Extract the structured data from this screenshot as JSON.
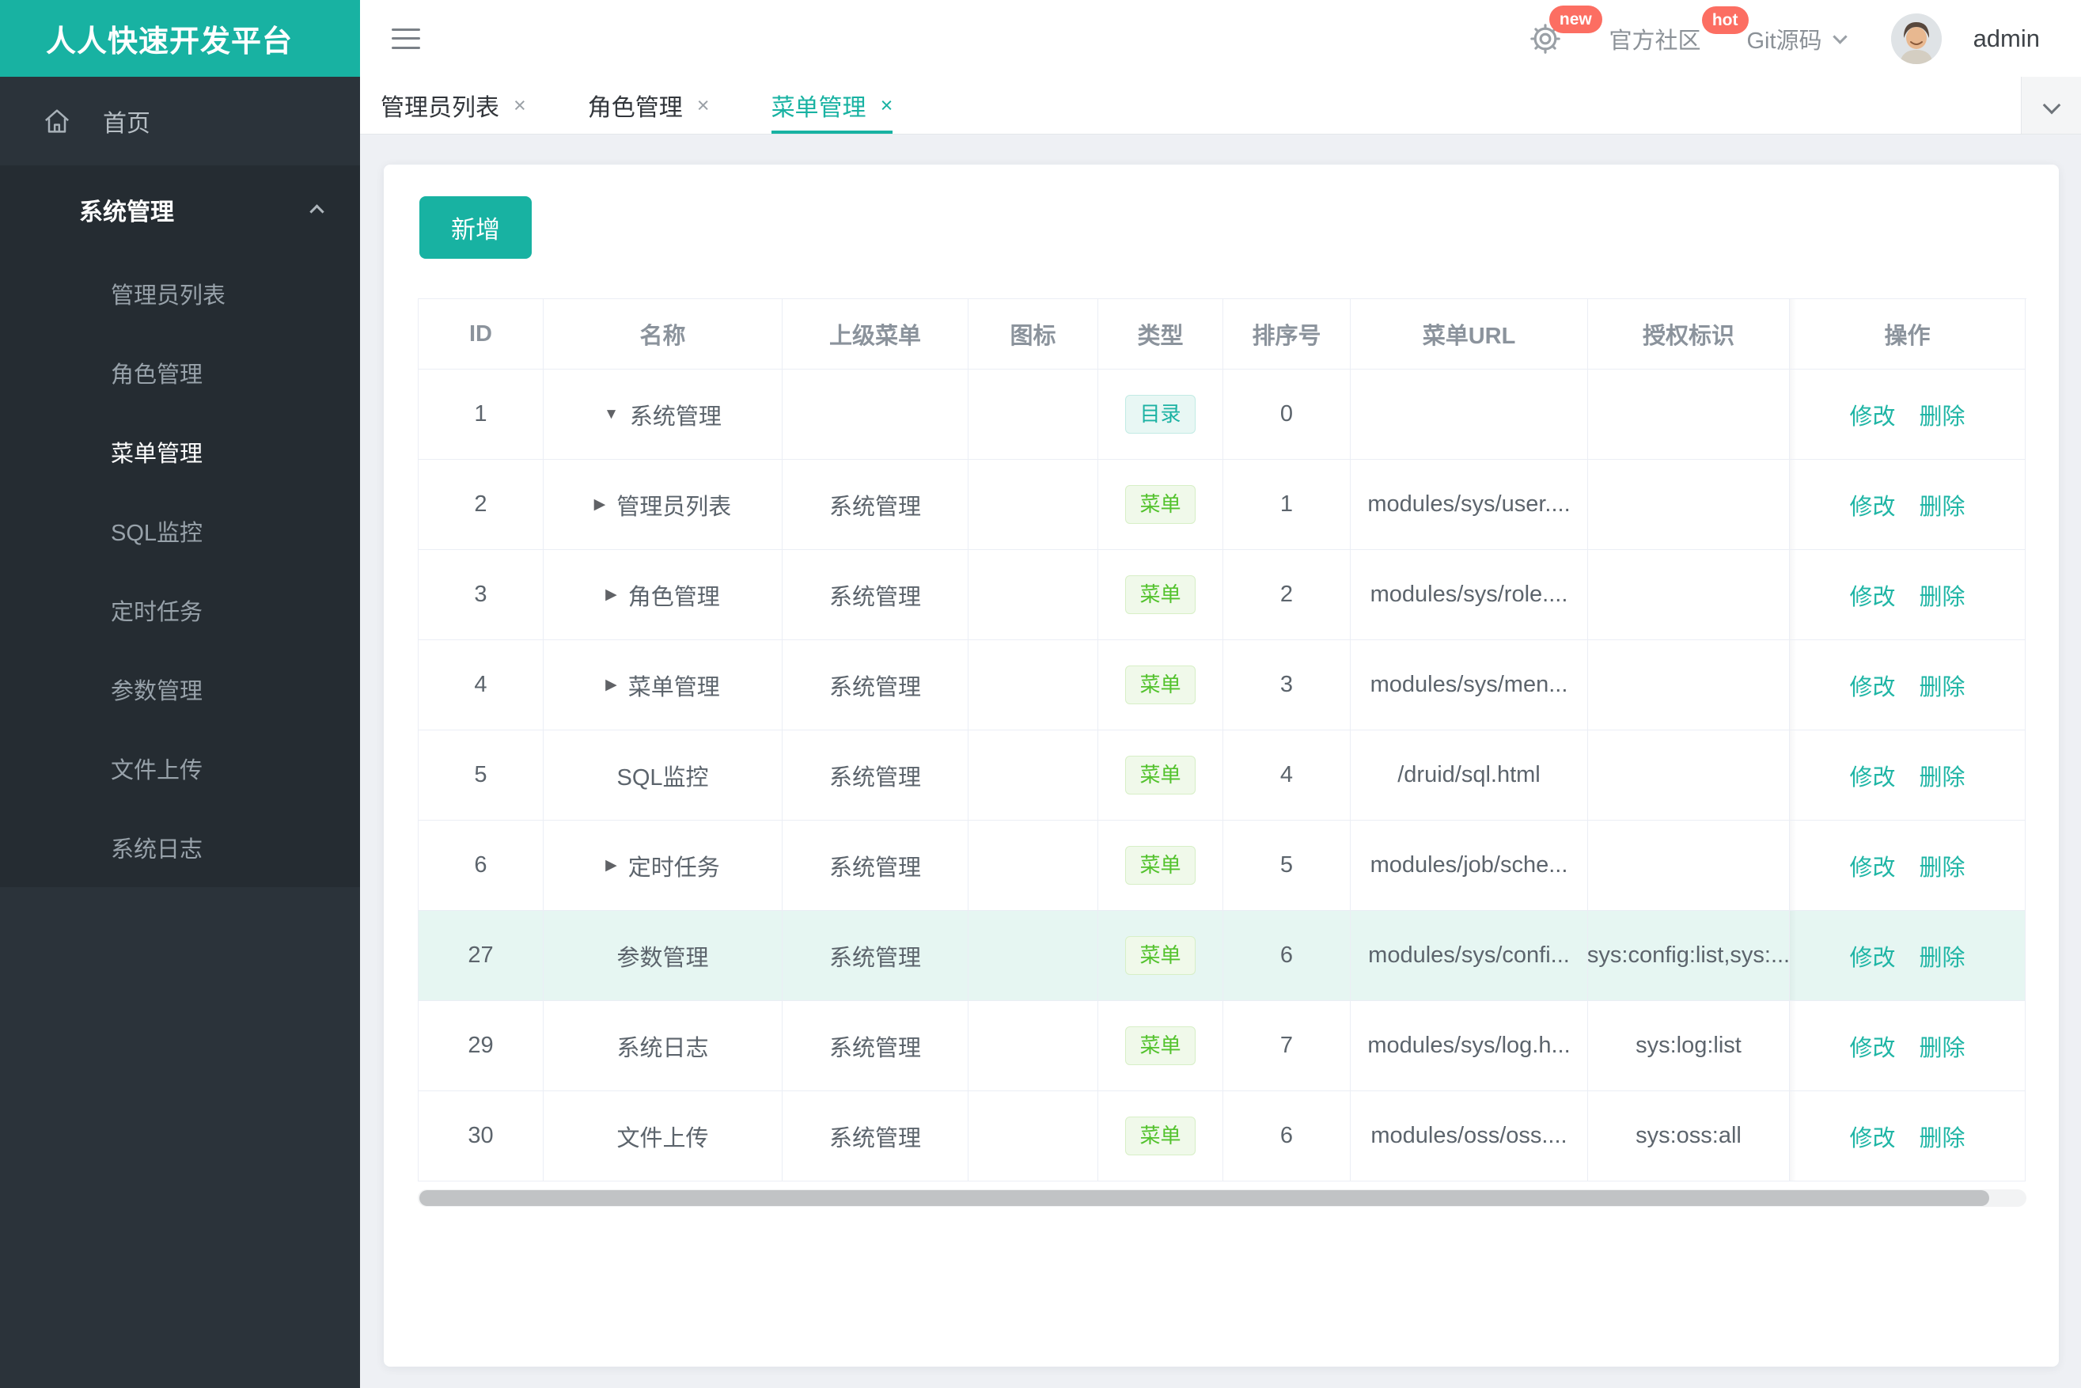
{
  "header": {
    "logo": "人人快速开发平台",
    "nav": {
      "new_badge": "new",
      "community": "官方社区",
      "hot_badge": "hot",
      "git": "Git源码",
      "username": "admin"
    }
  },
  "sidebar": {
    "home_label": "首页",
    "root_label": "系统管理",
    "items": [
      {
        "label": "管理员列表",
        "active": false
      },
      {
        "label": "角色管理",
        "active": false
      },
      {
        "label": "菜单管理",
        "active": true
      },
      {
        "label": "SQL监控",
        "active": false
      },
      {
        "label": "定时任务",
        "active": false
      },
      {
        "label": "参数管理",
        "active": false
      },
      {
        "label": "文件上传",
        "active": false
      },
      {
        "label": "系统日志",
        "active": false
      }
    ]
  },
  "tabs": [
    {
      "label": "管理员列表",
      "active": false
    },
    {
      "label": "角色管理",
      "active": false
    },
    {
      "label": "菜单管理",
      "active": true
    }
  ],
  "toolbar": {
    "add_label": "新增"
  },
  "table": {
    "columns": [
      "ID",
      "名称",
      "上级菜单",
      "图标",
      "类型",
      "排序号",
      "菜单URL",
      "授权标识",
      "操作"
    ],
    "actions": {
      "edit": "修改",
      "delete": "删除"
    },
    "rows": [
      {
        "id": "1",
        "arrow": "down",
        "name": "系统管理",
        "parent": "",
        "type": "目录",
        "kind": "dir",
        "order": "0",
        "url": "",
        "perms": "",
        "highlight": false
      },
      {
        "id": "2",
        "arrow": "right",
        "name": "管理员列表",
        "parent": "系统管理",
        "type": "菜单",
        "kind": "menu",
        "order": "1",
        "url": "modules/sys/user....",
        "perms": "",
        "highlight": false
      },
      {
        "id": "3",
        "arrow": "right",
        "name": "角色管理",
        "parent": "系统管理",
        "type": "菜单",
        "kind": "menu",
        "order": "2",
        "url": "modules/sys/role....",
        "perms": "",
        "highlight": false
      },
      {
        "id": "4",
        "arrow": "right",
        "name": "菜单管理",
        "parent": "系统管理",
        "type": "菜单",
        "kind": "menu",
        "order": "3",
        "url": "modules/sys/men...",
        "perms": "",
        "highlight": false
      },
      {
        "id": "5",
        "arrow": "",
        "name": "SQL监控",
        "parent": "系统管理",
        "type": "菜单",
        "kind": "menu",
        "order": "4",
        "url": "/druid/sql.html",
        "perms": "",
        "highlight": false
      },
      {
        "id": "6",
        "arrow": "right",
        "name": "定时任务",
        "parent": "系统管理",
        "type": "菜单",
        "kind": "menu",
        "order": "5",
        "url": "modules/job/sche...",
        "perms": "",
        "highlight": false
      },
      {
        "id": "27",
        "arrow": "",
        "name": "参数管理",
        "parent": "系统管理",
        "type": "菜单",
        "kind": "menu",
        "order": "6",
        "url": "modules/sys/confi...",
        "perms": "sys:config:list,sys:...",
        "highlight": true
      },
      {
        "id": "29",
        "arrow": "",
        "name": "系统日志",
        "parent": "系统管理",
        "type": "菜单",
        "kind": "menu",
        "order": "7",
        "url": "modules/sys/log.h...",
        "perms": "sys:log:list",
        "highlight": false
      },
      {
        "id": "30",
        "arrow": "",
        "name": "文件上传",
        "parent": "系统管理",
        "type": "菜单",
        "kind": "menu",
        "order": "6",
        "url": "modules/oss/oss....",
        "perms": "sys:oss:all",
        "highlight": false
      }
    ]
  },
  "colors": {
    "accent_teal": "#18b2a2",
    "badge_red": "#fc6e62",
    "tag_dir_text": "#1cb2a3",
    "tag_menu_text": "#53c22d",
    "row_highlight": "#e6f6f2",
    "sidebar_bg": "#2b333a"
  }
}
